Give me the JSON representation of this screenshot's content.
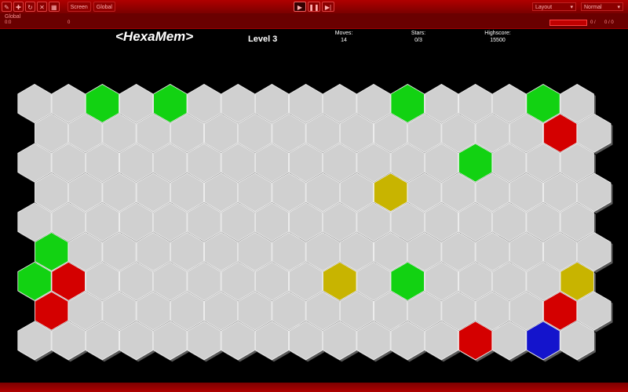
{
  "toolbar": {
    "tools": [
      "✎",
      "✚",
      "↻",
      "✕",
      "▦"
    ],
    "screen_label": "Screen",
    "global_label": "Global",
    "media": [
      "▶",
      "❚❚",
      "▶|"
    ],
    "combo1": "Layout",
    "combo2": "Normal"
  },
  "status": {
    "label": "Global",
    "sub": "0:0",
    "right1": "0",
    "right2": "0 /",
    "right3": "0 / 0"
  },
  "game": {
    "title": "<HexaMem>",
    "level": "Level 3",
    "moves_label": "Moves:",
    "moves_value": "14",
    "stars_label": "Stars:",
    "stars_value": "0/3",
    "highscore_label": "Highscore:",
    "highscore_value": "15500"
  },
  "colors": {
    "gray": "#d0d0d0",
    "green": "#12d212",
    "red": "#d40000",
    "yellow": "#c8b400",
    "blue": "#1414cc"
  },
  "board": {
    "rows": 9,
    "cols": 17,
    "tiles": [
      "GGgGgGGGGGGgGGGgG",
      "GGGGGGGGGGGGGGGrG",
      "GGGGGGGGGGGGGgGGG",
      "GGGGGGGGGGyGGGGGG",
      "GGGGGGGGGGGGGGGGG",
      "gGGGGGGGGGGGGGGGG",
      "grGGGGGGGyGgGGGGy",
      "rGGGGGGGGGGGGGGrG",
      "GGGGGGGGGGGGGrGbG"
    ]
  }
}
